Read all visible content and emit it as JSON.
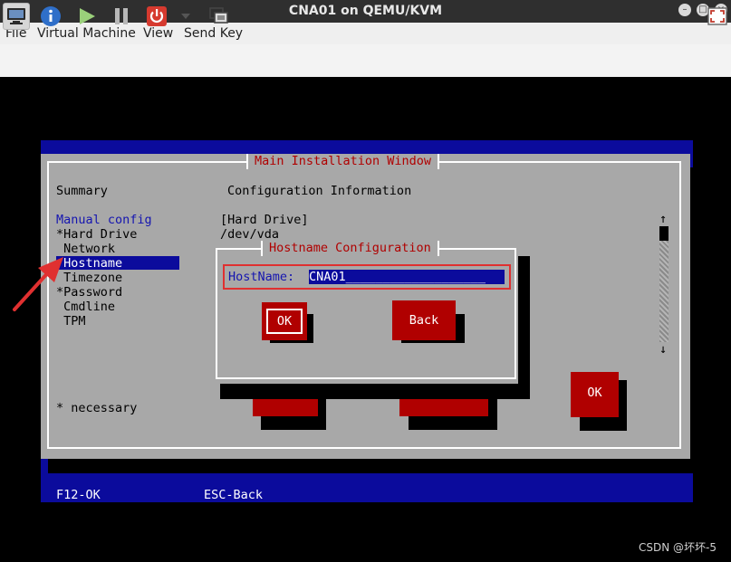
{
  "window": {
    "title": "CNA01 on QEMU/KVM"
  },
  "menubar": {
    "items": [
      "File",
      "Virtual Machine",
      "View",
      "Send Key"
    ]
  },
  "console": {
    "dialog_title": "Main Installation Window",
    "summary_heading": "Summary",
    "config_heading": "Configuration Information",
    "menu_heading": "Manual config",
    "menu_items": [
      "*Hard Drive",
      " Network",
      " Hostname",
      " Timezone",
      "*Password",
      " Cmdline",
      " TPM"
    ],
    "selected_item": " Hostname",
    "info_lines": [
      "[Hard Drive]",
      "/dev/vda"
    ],
    "necessary_note": "* necessary",
    "ok_label": "OK",
    "scroll_up": "↑",
    "scroll_down": "↓",
    "hostname_dialog": {
      "title": "Hostname Configuration",
      "field_label": "HostName:",
      "field_value": "CNA01___________________",
      "ok_label": "OK",
      "back_label": "Back"
    },
    "footer": {
      "f12": "F12-OK",
      "esc": "ESC-Back"
    }
  },
  "watermark": "CSDN @坏坏-5",
  "colors": {
    "console_blue": "#0b0b9c",
    "dialog_gray": "#a8a8a8",
    "button_red": "#b00000",
    "highlight_red": "#e03030"
  }
}
